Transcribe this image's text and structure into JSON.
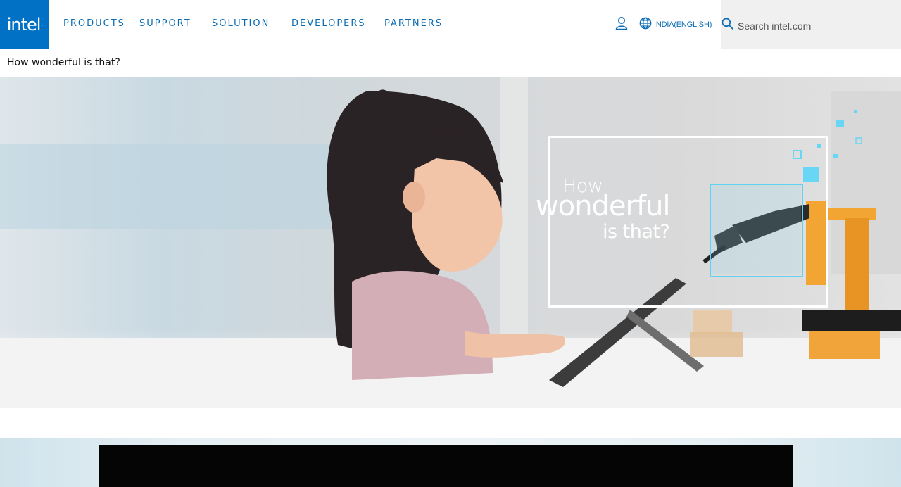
{
  "header": {
    "logo_text": "intel",
    "nav": [
      {
        "label": "PRODUCTS"
      },
      {
        "label": "SUPPORT"
      },
      {
        "label": "SOLUTION"
      },
      {
        "label": "DEVELOPERS"
      },
      {
        "label": "PARTNERS"
      }
    ],
    "user_icon": "user-icon",
    "globe_icon": "globe-icon",
    "locale_label": "INDIA(ENGLISH)",
    "search": {
      "placeholder": "Search intel.com",
      "value": "",
      "icon": "search-icon"
    }
  },
  "page": {
    "title": "How wonderful is that?"
  },
  "hero": {
    "line1": "How",
    "line2": "wonderful",
    "line3": "is that?"
  },
  "colors": {
    "brand": "#0071c5",
    "nav_text": "#0a6cb4",
    "search_bg": "#f0f0f0",
    "accent_cyan": "#5fd3f3"
  }
}
